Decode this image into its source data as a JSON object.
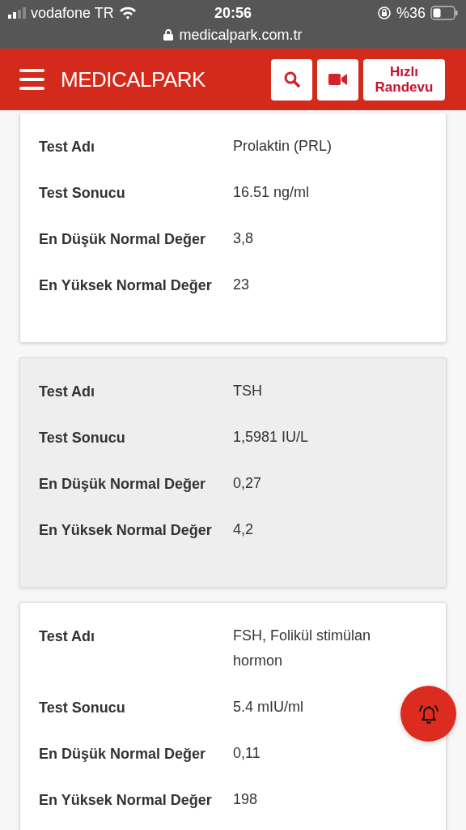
{
  "status_bar": {
    "carrier": "vodafone TR",
    "time": "20:56",
    "battery": "%36"
  },
  "address_bar": {
    "url": "medicalpark.com.tr"
  },
  "header": {
    "logo": "MEDICALPARK",
    "quick_appointment": "Hızlı Randevu"
  },
  "cards": [
    {
      "highlighted": false,
      "rows": [
        {
          "label": "Test Adı",
          "value": "Prolaktin (PRL)"
        },
        {
          "label": "Test Sonucu",
          "value": "16.51 ng/ml"
        },
        {
          "label": "En Düşük Normal Değer",
          "value": "3,8"
        },
        {
          "label": "En Yüksek Normal Değer",
          "value": "23"
        }
      ]
    },
    {
      "highlighted": true,
      "rows": [
        {
          "label": "Test Adı",
          "value": "TSH"
        },
        {
          "label": "Test Sonucu",
          "value": "1,5981 IU/L"
        },
        {
          "label": "En Düşük Normal Değer",
          "value": "0,27"
        },
        {
          "label": "En Yüksek Normal Değer",
          "value": "4,2"
        }
      ]
    },
    {
      "highlighted": false,
      "rows": [
        {
          "label": "Test Adı",
          "value": "FSH, Folikül stimülan hormon"
        },
        {
          "label": "Test Sonucu",
          "value": "5.4 mIU/ml"
        },
        {
          "label": "En Düşük Normal Değer",
          "value": "0,11"
        },
        {
          "label": "En Yüksek Normal Değer",
          "value": "198"
        }
      ]
    }
  ]
}
